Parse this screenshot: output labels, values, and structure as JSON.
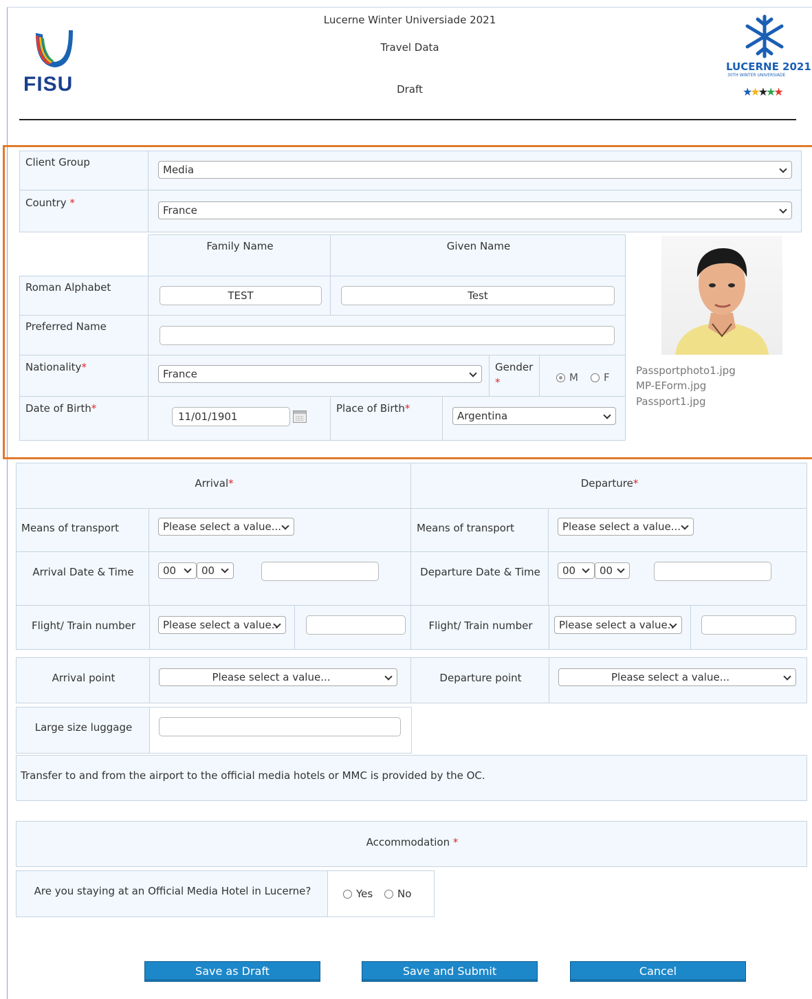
{
  "header": {
    "event_title": "Lucerne Winter Universiade 2021",
    "form_title": "Travel Data",
    "status": "Draft",
    "fisu_logo_text": "FISU",
    "lucerne_logo_text": "LUCERNE 2021",
    "lucerne_logo_subtext": "30TH WINTER UNIVERSIADE"
  },
  "personal": {
    "client_group_label": "Client Group",
    "client_group_value": "Media",
    "country_label": "Country",
    "country_value": "France",
    "family_name_header": "Family Name",
    "given_name_header": "Given Name",
    "roman_alphabet_label": "Roman Alphabet",
    "family_name_value": "TEST",
    "given_name_value": "Test",
    "preferred_name_label": "Preferred Name",
    "preferred_name_value": "",
    "nationality_label": "Nationality",
    "nationality_value": "France",
    "gender_label": "Gender",
    "gender_m": "M",
    "gender_f": "F",
    "gender_selected": "M",
    "dob_label": "Date of Birth",
    "dob_value": "11/01/1901",
    "pob_label": "Place of Birth",
    "pob_value": "Argentina",
    "required_mark": "*"
  },
  "files": [
    "Passportphoto1.jpg",
    "MP-EForm.jpg",
    "Passport1.jpg"
  ],
  "travel": {
    "arrival_header": "Arrival",
    "departure_header": "Departure",
    "means_label": "Means of transport",
    "select_placeholder": "Please select a value...",
    "select_placeholder_short": "Please select a value..",
    "arrival_datetime_label": "Arrival Date & Time",
    "departure_datetime_label": "Departure Date & Time",
    "hour_value": "00",
    "minute_value": "00",
    "flight_label": "Flight/ Train number",
    "arrival_point_label": "Arrival point",
    "departure_point_label": "Departure point",
    "luggage_label": "Large size luggage",
    "transfer_note": "Transfer to and from the airport to the official media hotels or MMC is provided by the OC."
  },
  "accommodation": {
    "header": "Accommodation",
    "question": "Are you staying at an Official Media Hotel in Lucerne?",
    "yes_label": "Yes",
    "no_label": "No"
  },
  "buttons": {
    "save_draft": "Save as Draft",
    "save_submit": "Save and Submit",
    "cancel": "Cancel"
  },
  "colors": {
    "accent_orange": "#e07a2a",
    "button_blue": "#1c87c9",
    "required_red": "#e0262b",
    "cell_bg": "#f2f8fd"
  }
}
